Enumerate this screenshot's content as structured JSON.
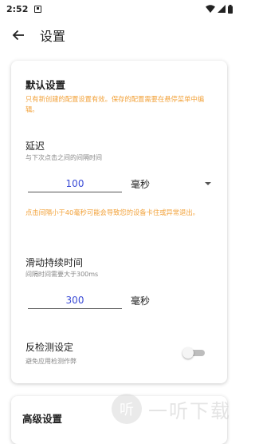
{
  "status_bar": {
    "time": "2:52"
  },
  "app_bar": {
    "title": "设置"
  },
  "default_settings": {
    "title": "默认设置",
    "note": "只有新创建的配置设置有效。保存的配置需要在悬停菜单中编辑。"
  },
  "delay": {
    "title": "延迟",
    "subtitle": "与下次点击之间的间隔时间",
    "value": "100",
    "unit": "毫秒",
    "warning": "点击间隔小于40毫秒可能会导致您的设备卡住或异常退出。"
  },
  "swipe_duration": {
    "title": "滑动持续时间",
    "subtitle": "间隔时间需要大于300ms",
    "value": "300",
    "unit": "毫秒"
  },
  "anti_detection": {
    "title": "反检测设定",
    "subtitle": "避免应用检测作弊",
    "enabled": false
  },
  "advanced_settings": {
    "title": "高级设置"
  },
  "watermark": {
    "logo_text": "听",
    "text": "一听下载"
  },
  "colors": {
    "accent": "#3a4bd6",
    "warning": "#f2a23a"
  }
}
